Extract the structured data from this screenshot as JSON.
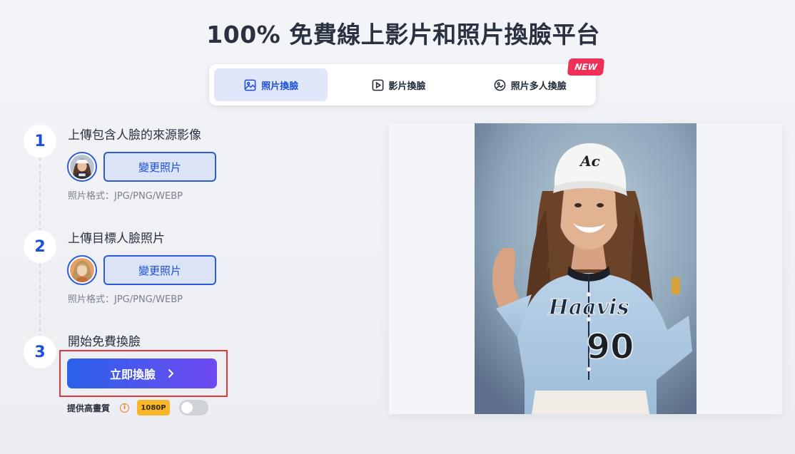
{
  "page": {
    "title": "100% 免費線上影片和照片換臉平台"
  },
  "tabs": [
    {
      "label": "照片換臉",
      "icon": "image-icon",
      "active": true
    },
    {
      "label": "影片換臉",
      "icon": "play-icon",
      "active": false
    },
    {
      "label": "照片多人換臉",
      "icon": "multi-face-icon",
      "active": false,
      "badge": "NEW"
    }
  ],
  "steps": [
    {
      "number": "1",
      "title": "上傳包含人臉的來源影像",
      "button": "變更照片",
      "hint": "照片格式：JPG/PNG/WEBP",
      "avatar": "source-face-thumbnail"
    },
    {
      "number": "2",
      "title": "上傳目標人臉照片",
      "button": "變更照片",
      "hint": "照片格式：JPG/PNG/WEBP",
      "avatar": "target-face-thumbnail"
    },
    {
      "number": "3",
      "title": "開始免費換臉"
    }
  ],
  "action": {
    "swap_label": "立即換臉",
    "swap_icon": "chevron-right-icon"
  },
  "quality": {
    "label": "提供高畫質",
    "info_icon": "info-icon",
    "badge": "1080P",
    "toggle_on": false
  },
  "preview": {
    "jersey_script": "Haavis",
    "jersey_number": "90",
    "cap_logo": "Ac"
  },
  "colors": {
    "accent": "#1d4fd8",
    "button_gradient_start": "#2a62e8",
    "button_gradient_end": "#7049f2",
    "badge_red": "#ef2f55",
    "hd_badge": "#f7b52b",
    "highlight": "#e03a3a"
  }
}
